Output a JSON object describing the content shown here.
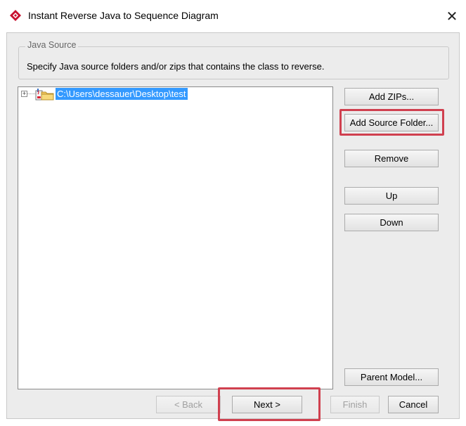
{
  "window": {
    "title": "Instant Reverse Java to Sequence Diagram",
    "close_glyph": "✕"
  },
  "group": {
    "legend": "Java Source",
    "description": "Specify Java source folders and/or zips that contains the class to reverse."
  },
  "tree": {
    "expander_glyph": "+",
    "items": [
      {
        "label": "C:\\Users\\dessauer\\Desktop\\test",
        "selected": true,
        "icon": "java-source-folder-icon"
      }
    ]
  },
  "side_buttons": {
    "add_zips": "Add ZIPs...",
    "add_source_folder": "Add Source Folder...",
    "remove": "Remove",
    "up": "Up",
    "down": "Down",
    "parent_model": "Parent Model..."
  },
  "footer_buttons": {
    "back": "< Back",
    "next": "Next >",
    "finish": "Finish",
    "cancel": "Cancel"
  },
  "colors": {
    "selection": "#3399ff",
    "highlight": "#d0404f",
    "dialog_bg": "#ececec"
  }
}
